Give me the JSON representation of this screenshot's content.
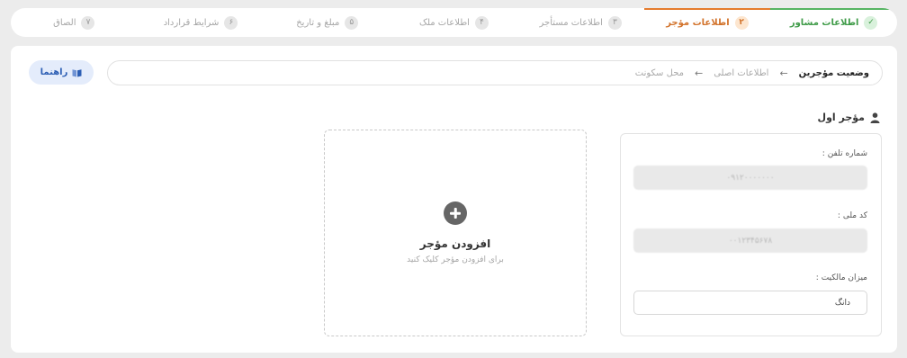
{
  "stepper": {
    "steps": [
      {
        "num": "✓",
        "label": "اطلاعات مشاور",
        "state": "done"
      },
      {
        "num": "۲",
        "label": "اطلاعات مؤجر",
        "state": "active"
      },
      {
        "num": "۳",
        "label": "اطلاعات مستأجر",
        "state": "pending"
      },
      {
        "num": "۴",
        "label": "اطلاعات ملک",
        "state": "pending"
      },
      {
        "num": "۵",
        "label": "مبلغ و تاریخ",
        "state": "pending"
      },
      {
        "num": "۶",
        "label": "شرایط قرارداد",
        "state": "pending"
      },
      {
        "num": "۷",
        "label": "الصاق",
        "state": "pending"
      }
    ]
  },
  "breadcrumb": {
    "current": "وضعیت مؤجرین",
    "arrow": "←",
    "items": [
      "اطلاعات اصلی",
      "محل سکونت"
    ]
  },
  "help_button": {
    "label": "راهنما",
    "icon": "book-icon"
  },
  "section": {
    "title": "مؤجر اول",
    "icon": "user-icon"
  },
  "form": {
    "phone_label": "شماره تلفن :",
    "phone_value": "۰۹۱۲۰۰۰۰۰۰۰",
    "national_id_label": "کد ملی :",
    "national_id_value": "۰۰۱۲۳۴۵۶۷۸",
    "ownership_label": "میزان مالکیت :",
    "ownership_value": "دانگ"
  },
  "add_tenant": {
    "title": "افزودن مؤجر",
    "subtitle": "برای افزودن مؤجر کلیک کنید",
    "icon": "plus-circle-icon"
  },
  "colors": {
    "done": "#3f9b48",
    "active": "#d2722a",
    "help_bg": "#e4ecfb",
    "help_text": "#2d5fb4"
  }
}
